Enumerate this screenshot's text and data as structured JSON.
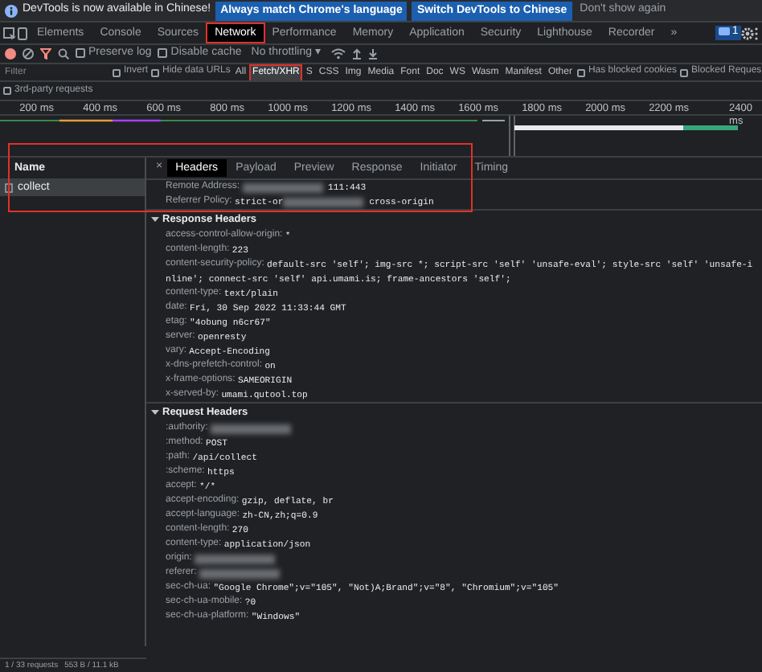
{
  "infobar": {
    "message": "DevTools is now available in Chinese!",
    "buttons": [
      "Always match Chrome's language",
      "Switch DevTools to Chinese"
    ],
    "dismiss": "Don't show again"
  },
  "tabs": [
    {
      "label": "Elements",
      "selected": false,
      "highlighted": false
    },
    {
      "label": "Console",
      "selected": false,
      "highlighted": false
    },
    {
      "label": "Sources",
      "selected": false,
      "highlighted": false
    },
    {
      "label": "Network",
      "selected": true,
      "highlighted": true
    },
    {
      "label": "Performance",
      "selected": false,
      "highlighted": false
    },
    {
      "label": "Memory",
      "selected": false,
      "highlighted": false
    },
    {
      "label": "Application",
      "selected": false,
      "highlighted": false
    },
    {
      "label": "Security",
      "selected": false,
      "highlighted": false
    },
    {
      "label": "Lighthouse",
      "selected": false,
      "highlighted": false
    },
    {
      "label": "Recorder",
      "selected": false,
      "highlighted": false
    }
  ],
  "tabs_overflow": "»",
  "issues_count": "1",
  "toolbar": {
    "recording": true,
    "checkboxes": [
      {
        "label": "Preserve log",
        "checked": false
      },
      {
        "label": "Disable cache",
        "checked": false
      }
    ],
    "throttling": "No throttling",
    "throttling_caret": "▾"
  },
  "filter": {
    "placeholder": "Filter",
    "checkboxes": [
      {
        "label": "Invert",
        "checked": false
      },
      {
        "label": "Hide data URLs",
        "checked": false
      }
    ],
    "types": [
      {
        "label": "All",
        "selected": false,
        "highlighted": false
      },
      {
        "label": "Fetch/XHR",
        "selected": true,
        "highlighted": true
      },
      {
        "label": "S",
        "selected": false,
        "highlighted": false
      },
      {
        "label": "CSS",
        "selected": false,
        "highlighted": false
      },
      {
        "label": "Img",
        "selected": false,
        "highlighted": false
      },
      {
        "label": "Media",
        "selected": false,
        "highlighted": false
      },
      {
        "label": "Font",
        "selected": false,
        "highlighted": false
      },
      {
        "label": "Doc",
        "selected": false,
        "highlighted": false
      },
      {
        "label": "WS",
        "selected": false,
        "highlighted": false
      },
      {
        "label": "Wasm",
        "selected": false,
        "highlighted": false
      },
      {
        "label": "Manifest",
        "selected": false,
        "highlighted": false
      },
      {
        "label": "Other",
        "selected": false,
        "highlighted": false
      }
    ],
    "more_checkboxes": [
      {
        "label": "Has blocked cookies",
        "checked": false
      },
      {
        "label": "Blocked Reques",
        "checked": false
      }
    ],
    "third_party": {
      "label": "3rd-party requests",
      "checked": false
    }
  },
  "timeline": {
    "ticks": [
      "200 ms",
      "400 ms",
      "600 ms",
      "800 ms",
      "1000 ms",
      "1200 ms",
      "1400 ms",
      "1600 ms",
      "1800 ms",
      "2000 ms",
      "2200 ms",
      "2400 ms"
    ]
  },
  "requests": {
    "header": "Name",
    "rows": [
      {
        "name": "collect",
        "selected": true
      }
    ]
  },
  "annotation_frame": true,
  "details": {
    "close": "×",
    "tabs": [
      {
        "label": "Headers",
        "selected": true
      },
      {
        "label": "Payload",
        "selected": false
      },
      {
        "label": "Preview",
        "selected": false
      },
      {
        "label": "Response",
        "selected": false
      },
      {
        "label": "Initiator",
        "selected": false
      },
      {
        "label": "Timing",
        "selected": false
      }
    ],
    "general": [
      {
        "key": "Remote Address:",
        "redacted": true,
        "value_after": "111:443"
      },
      {
        "key": "Referrer Policy:",
        "value": "strict-or",
        "redacted": true,
        "value_after": "cross-origin"
      }
    ],
    "sections": [
      {
        "title": "Response Headers",
        "expanded": true,
        "headers": [
          {
            "key": "access-control-allow-origin:",
            "value": "*",
            "redacted": false
          },
          {
            "key": "content-length:",
            "value": "223",
            "redacted": false
          },
          {
            "key": "content-security-policy:",
            "value": "default-src 'self'; img-src *; script-src 'self' 'unsafe-eval'; style-src 'self' 'unsafe-inline'; connect-src 'self' api.umami.is; frame-ancestors 'self';",
            "redacted": false
          },
          {
            "key": "content-type:",
            "value": "text/plain",
            "redacted": false
          },
          {
            "key": "date:",
            "value": "Fri, 30 Sep 2022 11:33:44 GMT",
            "redacted": false
          },
          {
            "key": "etag:",
            "value": "\"4obung n6cr67\"",
            "redacted": false
          },
          {
            "key": "server:",
            "value": "openresty",
            "redacted": false
          },
          {
            "key": "vary:",
            "value": "Accept-Encoding",
            "redacted": false
          },
          {
            "key": "x-dns-prefetch-control:",
            "value": "on",
            "redacted": false
          },
          {
            "key": "x-frame-options:",
            "value": "SAMEORIGIN",
            "redacted": false
          },
          {
            "key": "x-served-by:",
            "value": "umami.qutool.top",
            "redacted": false
          }
        ]
      },
      {
        "title": "Request Headers",
        "expanded": true,
        "headers": [
          {
            "key": ":authority:",
            "redacted": true
          },
          {
            "key": ":method:",
            "value": "POST",
            "redacted": false
          },
          {
            "key": ":path:",
            "value": "/api/collect",
            "redacted": false
          },
          {
            "key": ":scheme:",
            "value": "https",
            "redacted": false
          },
          {
            "key": "accept:",
            "value": "*/*",
            "redacted": false
          },
          {
            "key": "accept-encoding:",
            "value": "gzip, deflate, br",
            "redacted": false
          },
          {
            "key": "accept-language:",
            "value": "zh-CN,zh;q=0.9",
            "redacted": false
          },
          {
            "key": "content-length:",
            "value": "270",
            "redacted": false
          },
          {
            "key": "content-type:",
            "value": "application/json",
            "redacted": false
          },
          {
            "key": "origin:",
            "redacted": true
          },
          {
            "key": "referer:",
            "redacted": true
          },
          {
            "key": "sec-ch-ua:",
            "value": "\"Google Chrome\";v=\"105\", \"Not)A;Brand\";v=\"8\", \"Chromium\";v=\"105\"",
            "redacted": false
          },
          {
            "key": "sec-ch-ua-mobile:",
            "value": "?0",
            "redacted": false
          },
          {
            "key": "sec-ch-ua-platform:",
            "value": "\"Windows\"",
            "redacted": false
          }
        ]
      }
    ]
  },
  "status_bar": [
    "1 / 33 requests",
    "553 B / 11.1 kB"
  ]
}
